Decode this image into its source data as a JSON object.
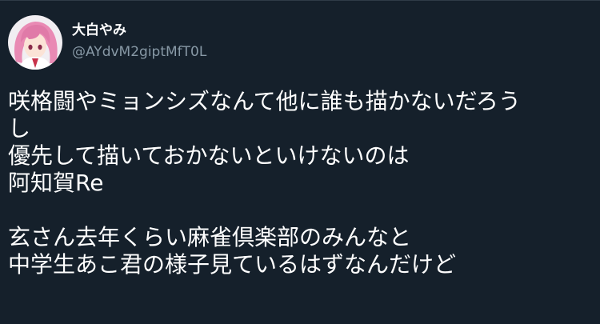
{
  "user": {
    "display_name": "大白やみ",
    "handle": "@AYdvM2giptMfT0L"
  },
  "tweet": {
    "lines": [
      "咲格闘やミョンシズなんて他に誰も描かないだろう",
      "し",
      "優先して描いておかないといけないのは",
      "阿知賀Re",
      "",
      "玄さん去年くらい麻雀倶楽部のみんなと",
      "中学生あこ君の様子見ているはずなんだけど"
    ]
  },
  "colors": {
    "background": "#15202b",
    "text": "#ffffff",
    "handle": "#8899a6",
    "avatar_hair": "#e98ab4"
  }
}
